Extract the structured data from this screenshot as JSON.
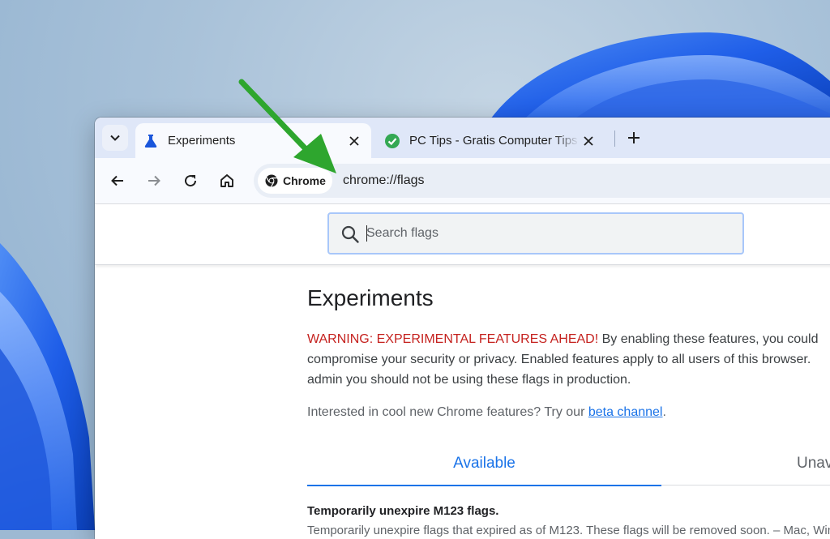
{
  "colors": {
    "accent": "#1a73e8",
    "warning_red": "#c5221f",
    "tab_strip": "#dfe7f8",
    "annotation_arrow": "#2ea62e"
  },
  "browser": {
    "tab_search_icon": "chevron-down-icon",
    "tabs": [
      {
        "title": "Experiments",
        "icon": "flask-icon",
        "active": true
      },
      {
        "title": "PC Tips - Gratis Computer Tips",
        "icon": "check-circle-icon",
        "active": false
      }
    ],
    "new_tab_icon": "plus-icon",
    "toolbar": {
      "back_icon": "arrow-left-icon",
      "forward_icon": "arrow-right-icon",
      "reload_icon": "reload-icon",
      "home_icon": "home-icon"
    },
    "omnibox": {
      "chip_label": "Chrome",
      "url": "chrome://flags"
    }
  },
  "page": {
    "search_placeholder": "Search flags",
    "title": "Experiments",
    "warning_prefix": "WARNING: EXPERIMENTAL FEATURES AHEAD!",
    "warning_line1_rest": " By enabling these features, you could",
    "warning_line2": "compromise your security or privacy. Enabled features apply to all users of this browser.",
    "warning_line3": "admin you should not be using these flags in production.",
    "interest_text": "Interested in cool new Chrome features? Try our ",
    "interest_link": "beta channel",
    "interest_end": ".",
    "tabs": [
      {
        "label": "Available",
        "selected": true
      },
      {
        "label": "Unavailable",
        "selected": false
      }
    ],
    "flag": {
      "title": "Temporarily unexpire M123 flags.",
      "description": "Temporarily unexpire flags that expired as of M123. These flags will be removed soon. – Mac, Windows"
    }
  }
}
